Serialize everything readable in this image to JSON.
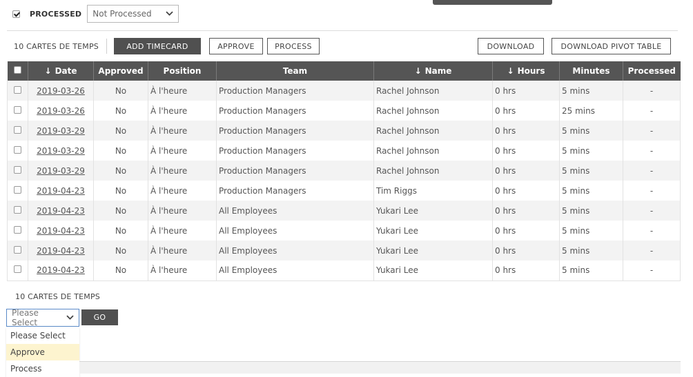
{
  "filter": {
    "checkbox_checked": true,
    "label": "PROCESSED",
    "select_value": "Not Processed"
  },
  "toolbar": {
    "count_label": "10 CARTES DE TEMPS",
    "add_timecard": "ADD TIMECARD",
    "approve": "APPROVE",
    "process": "PROCESS",
    "download": "DOWNLOAD",
    "download_pivot": "DOWNLOAD PIVOT TABLE"
  },
  "table": {
    "headers": {
      "date": "Date",
      "approved": "Approved",
      "position": "Position",
      "team": "Team",
      "name": "Name",
      "hours": "Hours",
      "minutes": "Minutes",
      "processed": "Processed"
    },
    "sort_arrow": "↓",
    "rows": [
      {
        "date": "2019-03-26",
        "approved": "No",
        "position": "À l'heure",
        "team": "Production Managers",
        "name": "Rachel Johnson",
        "hours": "0 hrs",
        "minutes": "5 mins",
        "processed": "-"
      },
      {
        "date": "2019-03-26",
        "approved": "No",
        "position": "À l'heure",
        "team": "Production Managers",
        "name": "Rachel Johnson",
        "hours": "0 hrs",
        "minutes": "25 mins",
        "processed": "-"
      },
      {
        "date": "2019-03-29",
        "approved": "No",
        "position": "À l'heure",
        "team": "Production Managers",
        "name": "Rachel Johnson",
        "hours": "0 hrs",
        "minutes": "5 mins",
        "processed": "-"
      },
      {
        "date": "2019-03-29",
        "approved": "No",
        "position": "À l'heure",
        "team": "Production Managers",
        "name": "Rachel Johnson",
        "hours": "0 hrs",
        "minutes": "5 mins",
        "processed": "-"
      },
      {
        "date": "2019-03-29",
        "approved": "No",
        "position": "À l'heure",
        "team": "Production Managers",
        "name": "Rachel Johnson",
        "hours": "0 hrs",
        "minutes": "5 mins",
        "processed": "-"
      },
      {
        "date": "2019-04-23",
        "approved": "No",
        "position": "À l'heure",
        "team": "Production Managers",
        "name": "Tim Riggs",
        "hours": "0 hrs",
        "minutes": "5 mins",
        "processed": "-"
      },
      {
        "date": "2019-04-23",
        "approved": "No",
        "position": "À l'heure",
        "team": "All Employees",
        "name": "Yukari Lee",
        "hours": "0 hrs",
        "minutes": "5 mins",
        "processed": "-"
      },
      {
        "date": "2019-04-23",
        "approved": "No",
        "position": "À l'heure",
        "team": "All Employees",
        "name": "Yukari Lee",
        "hours": "0 hrs",
        "minutes": "5 mins",
        "processed": "-"
      },
      {
        "date": "2019-04-23",
        "approved": "No",
        "position": "À l'heure",
        "team": "All Employees",
        "name": "Yukari Lee",
        "hours": "0 hrs",
        "minutes": "5 mins",
        "processed": "-"
      },
      {
        "date": "2019-04-23",
        "approved": "No",
        "position": "À l'heure",
        "team": "All Employees",
        "name": "Yukari Lee",
        "hours": "0 hrs",
        "minutes": "5 mins",
        "processed": "-"
      }
    ]
  },
  "bottom": {
    "count_label": "10 CARTES DE TEMPS",
    "select_value": "Please Select",
    "go": "GO",
    "options": [
      "Please Select",
      "Approve",
      "Process"
    ],
    "highlighted_option": "Approve"
  },
  "colors": {
    "header_bg": "#555555",
    "dark_button": "#505050",
    "highlight": "#fdf4cf",
    "select_focus": "#5a8ac8"
  },
  "icons": {
    "checkbox": "checkbox-icon",
    "chevron": "chevron-down-icon",
    "sort": "sort-down-arrow-icon"
  }
}
